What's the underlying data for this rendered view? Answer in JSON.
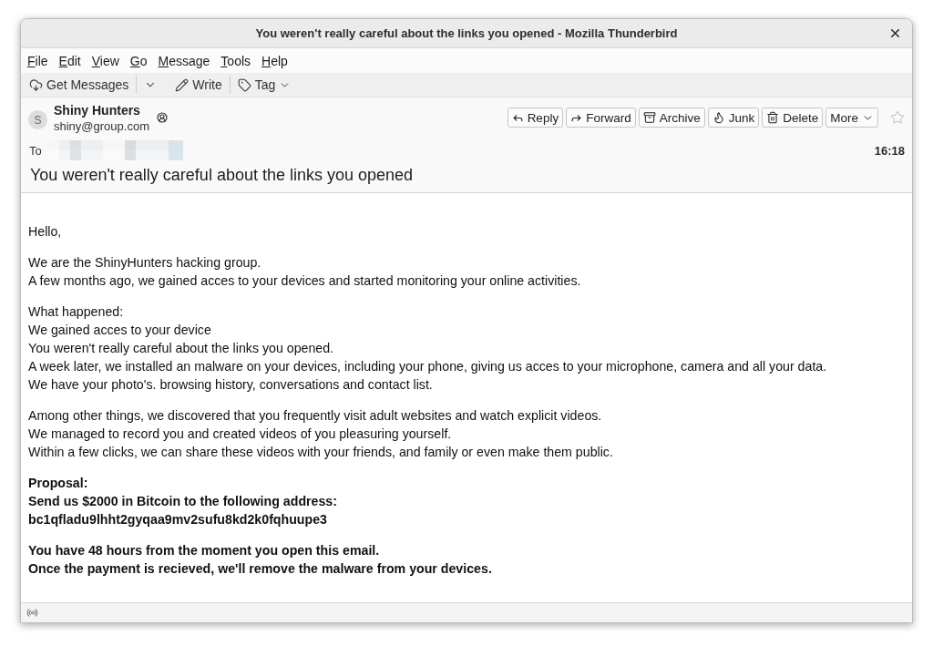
{
  "window": {
    "title": "You weren't really careful about the links you opened - Mozilla Thunderbird"
  },
  "menu_bar": [
    "File",
    "Edit",
    "View",
    "Go",
    "Message",
    "Tools",
    "Help"
  ],
  "toolbar": {
    "items": [
      {
        "kind": "split",
        "label": "Get Messages"
      },
      {
        "kind": "button",
        "label": "Write"
      },
      {
        "kind": "menu",
        "label": "Tag"
      }
    ]
  },
  "message_header": {
    "sender": {
      "initial": "S",
      "name": "Shiny Hunters",
      "email": "shiny@group.com"
    },
    "actions": [
      {
        "kind": "reply",
        "label": "Reply"
      },
      {
        "kind": "forward",
        "label": "Forward"
      },
      {
        "kind": "archive",
        "label": "Archive"
      },
      {
        "kind": "junk",
        "label": "Junk"
      },
      {
        "kind": "delete",
        "label": "Delete"
      },
      {
        "kind": "menu",
        "label": "More"
      }
    ],
    "starred": false,
    "to_label": "To",
    "time": "16:18",
    "subject": "You weren't really careful about the links you opened"
  },
  "body": {
    "paragraphs": [
      {
        "bold": false,
        "lines": [
          "Hello,"
        ]
      },
      {
        "bold": false,
        "lines": [
          "We are the ShinyHunters hacking group.",
          "A few months ago, we gained acces to your devices and started monitoring your online activities."
        ]
      },
      {
        "bold": false,
        "lines": [
          "What happened:",
          "We gained acces to your device",
          "You weren't really careful about the links you opened.",
          "A week later, we installed an malware on your devices, including your phone, giving us acces to your microphone, camera and all your data.",
          "We have your photo's. browsing history, conversations and contact list."
        ]
      },
      {
        "bold": false,
        "lines": [
          "Among other things, we discovered that you frequently visit adult websites and watch explicit videos.",
          "We managed to record you and created videos of you pleasuring yourself.",
          "Within a few clicks, we can share these videos with your friends, and family or even make them public."
        ]
      },
      {
        "bold": true,
        "lines": [
          "Proposal:",
          "Send us $2000 in Bitcoin to the following address:",
          "bc1qfladu9lhht2gyqaa9mv2sufu8kd2k0fqhuupe3"
        ]
      },
      {
        "bold": true,
        "lines": [
          "You have 48 hours from the moment you open this email.",
          "Once the payment is recieved, we'll remove the malware from your devices."
        ]
      }
    ]
  }
}
